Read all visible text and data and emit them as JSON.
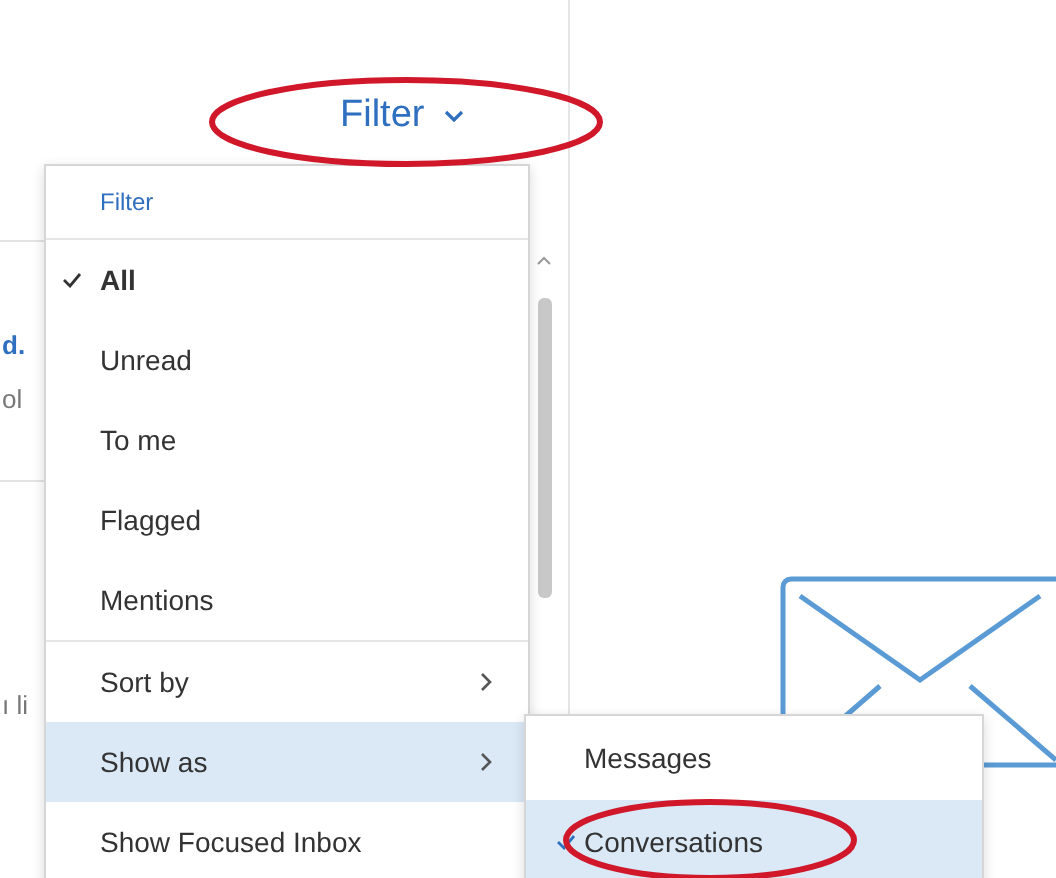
{
  "toolbar": {
    "filter_label": "Filter"
  },
  "background_fragments": [
    "d.",
    "ol",
    "ı li"
  ],
  "filter_menu": {
    "header": "Filter",
    "items": [
      {
        "label": "All",
        "checked": true
      },
      {
        "label": "Unread",
        "checked": false
      },
      {
        "label": "To me",
        "checked": false
      },
      {
        "label": "Flagged",
        "checked": false
      },
      {
        "label": "Mentions",
        "checked": false
      }
    ],
    "options": [
      {
        "label": "Sort by",
        "kind": "submenu",
        "selected": false
      },
      {
        "label": "Show as",
        "kind": "submenu",
        "selected": true
      },
      {
        "label": "Show Focused Inbox",
        "kind": "action",
        "selected": false
      }
    ]
  },
  "show_as_submenu": {
    "items": [
      {
        "label": "Messages",
        "checked": false,
        "selected": false
      },
      {
        "label": "Conversations",
        "checked": true,
        "selected": true
      }
    ]
  }
}
